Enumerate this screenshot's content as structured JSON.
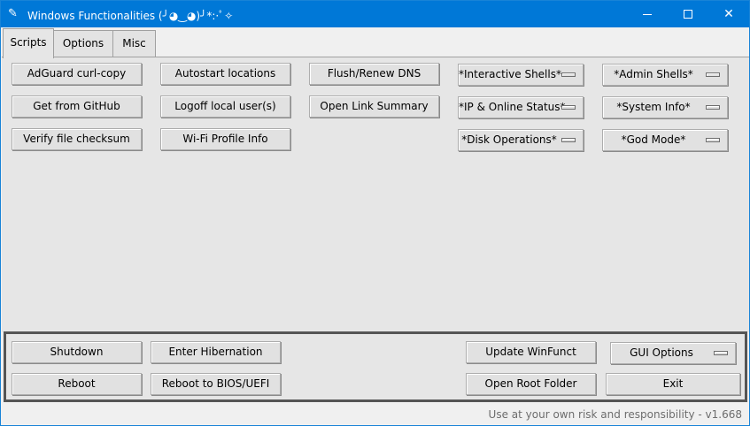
{
  "window": {
    "title": "Windows Functionalities (╯◕‿◕)╯*:·ﾟ✧",
    "app_icon": "feather-icon",
    "accent": "#0078d7"
  },
  "tabs": [
    {
      "label": "Scripts",
      "active": true
    },
    {
      "label": "Options",
      "active": false
    },
    {
      "label": "Misc",
      "active": false
    }
  ],
  "scripts": {
    "col1": [
      "AdGuard curl-copy",
      "Get from GitHub",
      "Verify file checksum"
    ],
    "col2": [
      "Autostart locations",
      "Logoff local user(s)",
      "Wi-Fi Profile Info"
    ],
    "col3": [
      "Flush/Renew DNS",
      "Open Link Summary"
    ],
    "menus_col1": [
      "*Interactive Shells*",
      "*IP & Online Status*",
      "*Disk Operations*"
    ],
    "menus_col2": [
      "*Admin Shells*",
      "*System Info*",
      "*God Mode*"
    ]
  },
  "bottom": {
    "shutdown": "Shutdown",
    "hibernate": "Enter Hibernation",
    "update": "Update WinFunct",
    "gui_options": "GUI Options",
    "reboot": "Reboot",
    "reboot_bios": "Reboot to BIOS/UEFI",
    "open_root": "Open Root Folder",
    "exit": "Exit"
  },
  "status": "Use at your own risk and responsibility - v1.668"
}
